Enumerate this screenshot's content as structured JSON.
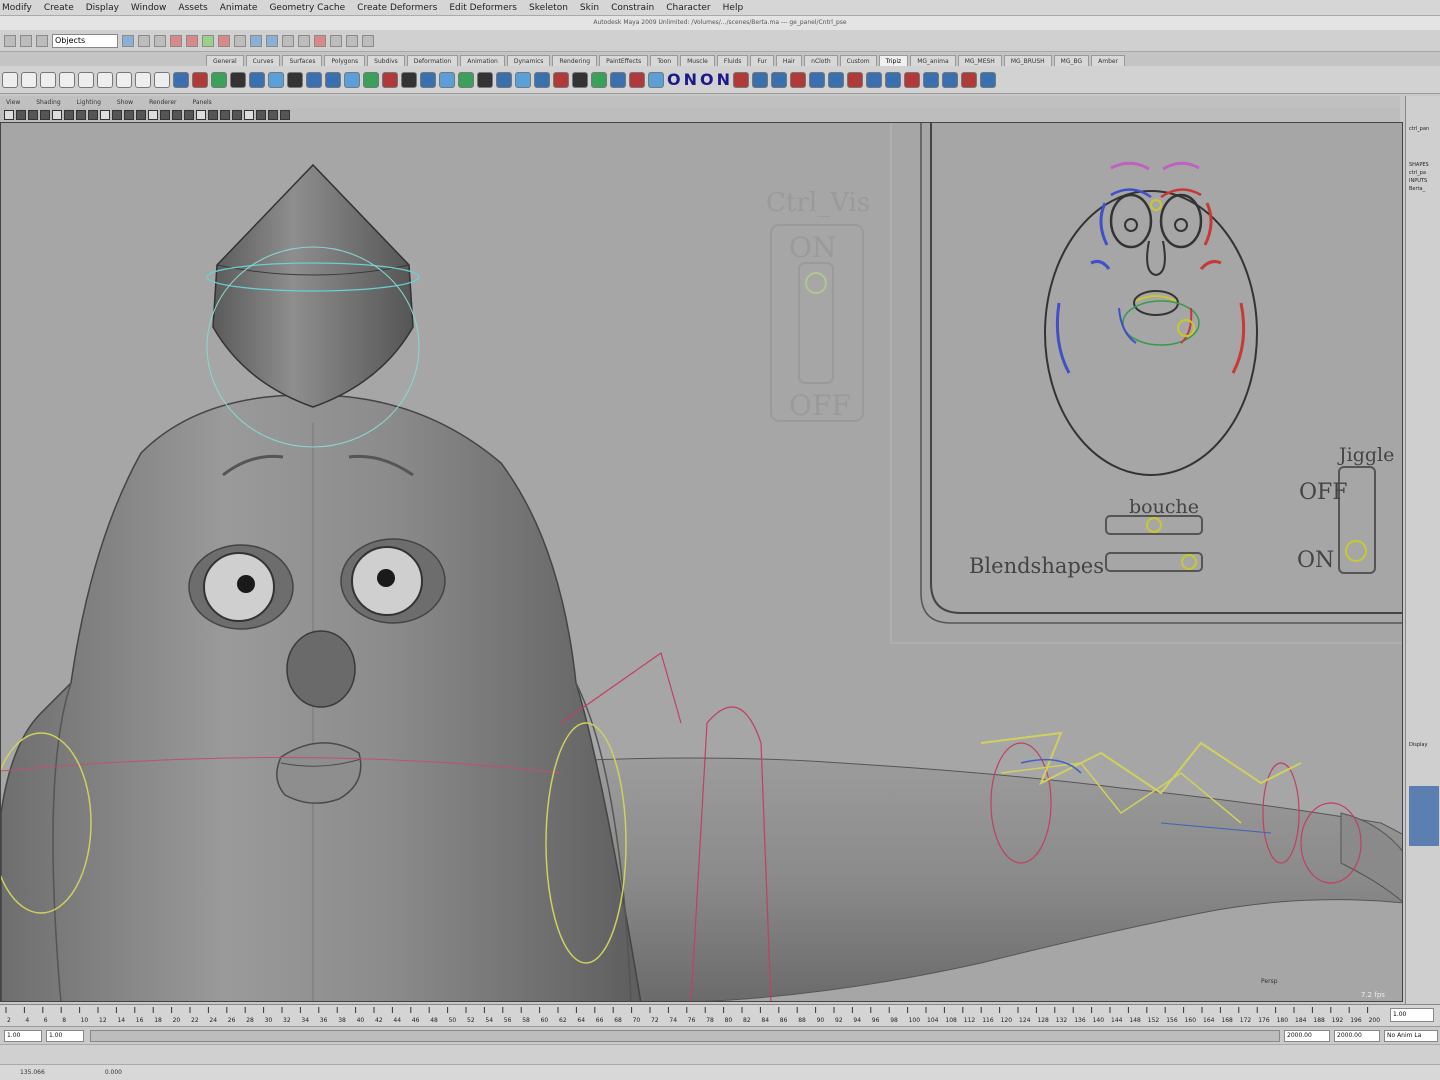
{
  "menubar": [
    "Modify",
    "Create",
    "Display",
    "Window",
    "Assets",
    "Animate",
    "Geometry Cache",
    "Create Deformers",
    "Edit Deformers",
    "Skeleton",
    "Skin",
    "Constrain",
    "Character",
    "Help"
  ],
  "window_title": "Autodesk Maya 2009 Unlimited: /Volumes/.../scenes/Berta.ma --- ge_panel/Cntrl_pse",
  "status_line": {
    "mode_select": "Objects"
  },
  "shelf_tabs": [
    "General",
    "Curves",
    "Surfaces",
    "Polygons",
    "Subdivs",
    "Deformation",
    "Animation",
    "Dynamics",
    "Rendering",
    "PaintEffects",
    "Toon",
    "Muscle",
    "Fluids",
    "Fur",
    "Hair",
    "nCloth",
    "Custom",
    "Tripiz",
    "MG_anima",
    "MG_MESH",
    "MG_BRUSH",
    "MG_BG",
    "Amber"
  ],
  "active_shelf_tab": "Tripiz",
  "shelf_text_glyphs": [
    "O",
    "N",
    "O",
    "N"
  ],
  "panel_menu": [
    "View",
    "Shading",
    "Lighting",
    "Show",
    "Renderer",
    "Panels"
  ],
  "viewport": {
    "ctrl_vis_label": "Ctrl_Vis",
    "ctrl_vis_on": "ON",
    "ctrl_vis_off": "OFF",
    "panel_bouche": "bouche",
    "panel_blendshapes": "Blendshapes",
    "panel_jiggle": "Jiggle",
    "panel_jiggle_off": "OFF",
    "panel_jiggle_on": "ON",
    "fps_readout": "7.2 fps",
    "camera_label": "Persp"
  },
  "right_panel": {
    "channel_title": "ctrl_pan",
    "shapes_label": "SHAPES",
    "inputs_label": "INPUTS",
    "shape_item": "ctrl_pa",
    "input_item": "Berta_",
    "display_label": "Display"
  },
  "timeline": {
    "ticks": [
      "2",
      "4",
      "6",
      "8",
      "10",
      "12",
      "14",
      "16",
      "18",
      "20",
      "22",
      "24",
      "26",
      "28",
      "30",
      "32",
      "34",
      "36",
      "38",
      "40",
      "42",
      "44",
      "46",
      "48",
      "50",
      "52",
      "54",
      "56",
      "58",
      "60",
      "62",
      "64",
      "66",
      "68",
      "70",
      "72",
      "74",
      "76",
      "78",
      "80",
      "82",
      "84",
      "86",
      "88",
      "90",
      "92",
      "94",
      "96",
      "98",
      "100",
      "104",
      "108",
      "112",
      "116",
      "120",
      "124",
      "128",
      "132",
      "136",
      "140",
      "144",
      "148",
      "152",
      "156",
      "160",
      "164",
      "168",
      "172",
      "176",
      "180",
      "184",
      "188",
      "192",
      "196",
      "200"
    ],
    "current_frame": "1.00"
  },
  "range": {
    "start_a": "1.00",
    "start_b": "1.00",
    "end_a": "2000.00",
    "end_b": "2000.00",
    "anim_layer": "No Anim La"
  },
  "helpline": [
    "135.066",
    "0.000"
  ]
}
